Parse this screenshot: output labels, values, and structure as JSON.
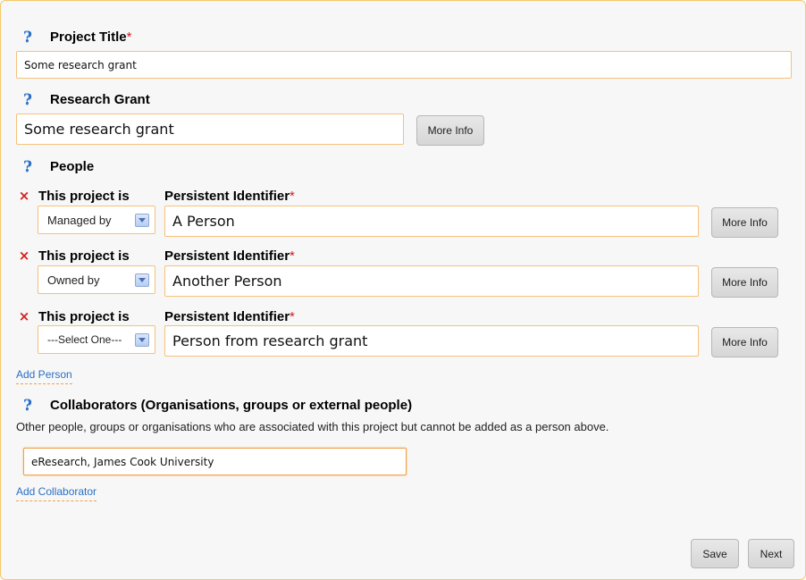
{
  "project_title": {
    "label": "Project Title",
    "required_mark": "*",
    "value": "Some research grant"
  },
  "research_grant": {
    "label": "Research Grant",
    "value": "Some research grant",
    "more_info": "More Info"
  },
  "people": {
    "label": "People",
    "rows": [
      {
        "relation_label": "This project is",
        "relation_value": "Managed by",
        "id_label": "Persistent Identifier",
        "required_mark": "*",
        "id_value": "A Person",
        "more_info": "More Info",
        "remove": "×"
      },
      {
        "relation_label": "This project is",
        "relation_value": "Owned by",
        "id_label": "Persistent Identifier",
        "required_mark": "*",
        "id_value": "Another Person",
        "more_info": "More Info",
        "remove": "×"
      },
      {
        "relation_label": "This project is",
        "relation_value": "---Select One---",
        "id_label": "Persistent Identifier",
        "required_mark": "*",
        "id_value": "Person from research grant",
        "more_info": "More Info",
        "remove": "×"
      }
    ],
    "add_link": "Add Person"
  },
  "collaborators": {
    "label": "Collaborators (Organisations, groups or external people)",
    "description": "Other people, groups or organisations who are associated with this project but cannot be added as a person above.",
    "value": "eResearch, James Cook University",
    "add_link": "Add Collaborator"
  },
  "actions": {
    "save": "Save",
    "next": "Next"
  },
  "help_glyph": "?",
  "colors": {
    "accent_border": "#f5c17a",
    "link": "#2a6fc4",
    "required": "#d01c1c",
    "remove": "#d31f1f"
  },
  "icons": {
    "help": "question-mark-icon",
    "remove": "cross-icon",
    "dropdown": "chevron-down-icon"
  }
}
